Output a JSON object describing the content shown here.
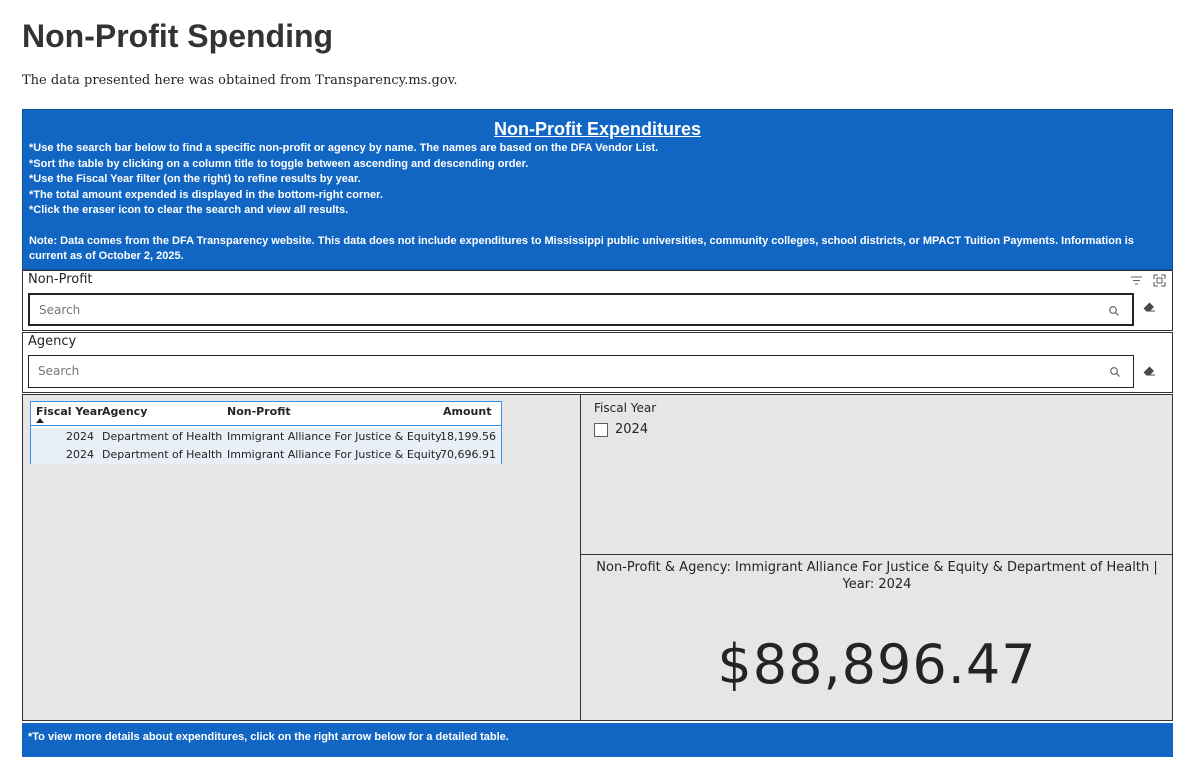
{
  "page": {
    "title": "Non-Profit Spending",
    "subtitle": "The data presented here was obtained from Transparency.ms.gov."
  },
  "banner": {
    "title": "Non-Profit Expenditures",
    "lines": [
      "*Use the search bar below to find a specific non-profit or agency by name. The names are based on the DFA Vendor List.",
      "*Sort the table by clicking on a column title to toggle between ascending and descending order.",
      "*Use the Fiscal Year filter (on the right) to refine results by year.",
      "*The total amount expended is displayed in the bottom-right corner.",
      "*Click the eraser icon to clear the search and view all results."
    ],
    "note": "Note: Data comes from the DFA Transparency website. This data does not include expenditures to Mississippi public universities, community colleges, school districts, or MPACT Tuition Payments. Information is current as of October 2, 2025."
  },
  "nonprofit_slicer": {
    "label": "Non-Profit",
    "placeholder": "Search",
    "icons": [
      "filter-icon",
      "focus-mode-icon",
      "search-icon",
      "eraser-icon"
    ]
  },
  "agency_slicer": {
    "label": "Agency",
    "placeholder": "Search",
    "icons": [
      "search-icon",
      "eraser-icon"
    ]
  },
  "table": {
    "columns": [
      "Fiscal Year",
      "Agency",
      "Non-Profit",
      "Amount"
    ],
    "sort_column": "Fiscal Year",
    "sort_direction": "ascending",
    "rows": [
      {
        "year": "2024",
        "agency": "Department of Health",
        "nonprofit": "Immigrant Alliance For Justice & Equity",
        "amount": "18,199.56"
      },
      {
        "year": "2024",
        "agency": "Department of Health",
        "nonprofit": "Immigrant Alliance For Justice & Equity",
        "amount": "70,696.91"
      }
    ]
  },
  "fiscal_year_slicer": {
    "label": "Fiscal Year",
    "options": [
      {
        "value": "2024",
        "checked": false
      }
    ]
  },
  "total_card": {
    "title": "Non-Profit & Agency: Immigrant Alliance For Justice & Equity & Department of Health | Year: 2024",
    "value": "$88,896.47"
  },
  "footer": {
    "text": "*To view more details about expenditures, click on the right arrow below for a detailed table."
  },
  "colors": {
    "banner_blue": "#1266c3",
    "panel_gray": "#e6e6e6",
    "table_accent": "#3a8ee6"
  }
}
